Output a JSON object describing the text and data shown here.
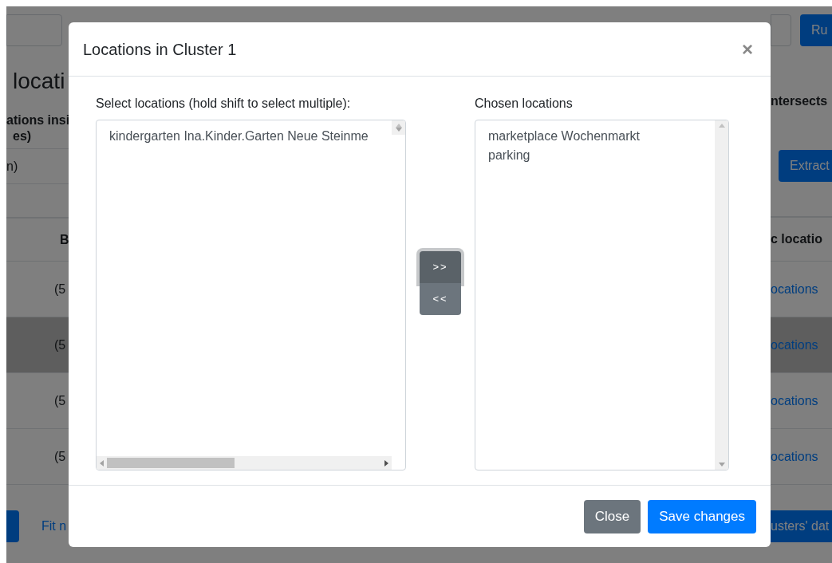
{
  "page": {
    "run_button": "Ru",
    "heading": "locati",
    "description_lines": [
      "ations insi",
      "es)"
    ],
    "field_value": "n)",
    "intersects_text": "ntersects",
    "extract_button": "Extract",
    "column_header_left": "B",
    "column_header_right": "c locatio",
    "rows": [
      {
        "cell": "(5",
        "link": "ocations",
        "selected": false
      },
      {
        "cell": "(5",
        "link": "ocations",
        "selected": true
      },
      {
        "cell": "(5",
        "link": "ocations",
        "selected": false
      },
      {
        "cell": "(5",
        "link": "ocations",
        "selected": false
      }
    ],
    "fit_link": "Fit n",
    "bottom_button": "usters' dat"
  },
  "modal": {
    "title": "Locations in Cluster 1",
    "close": "×",
    "available_label": "Select locations (hold shift to select multiple):",
    "chosen_label": "Chosen locations",
    "available": [
      {
        "label": "kindergarten Ina.Kinder.Garten Neue Steinme",
        "selected": false
      }
    ],
    "chosen": [
      {
        "label": "marketplace Wochenmarkt",
        "selected": false
      },
      {
        "label": "parking",
        "selected": false
      }
    ],
    "move_buttons": [
      {
        "label": ">>",
        "focused": true
      },
      {
        "label": "<<",
        "focused": false
      }
    ],
    "footer_buttons": [
      {
        "label": "Close",
        "kind": "secondary"
      },
      {
        "label": "Save changes",
        "kind": "primary"
      }
    ]
  }
}
